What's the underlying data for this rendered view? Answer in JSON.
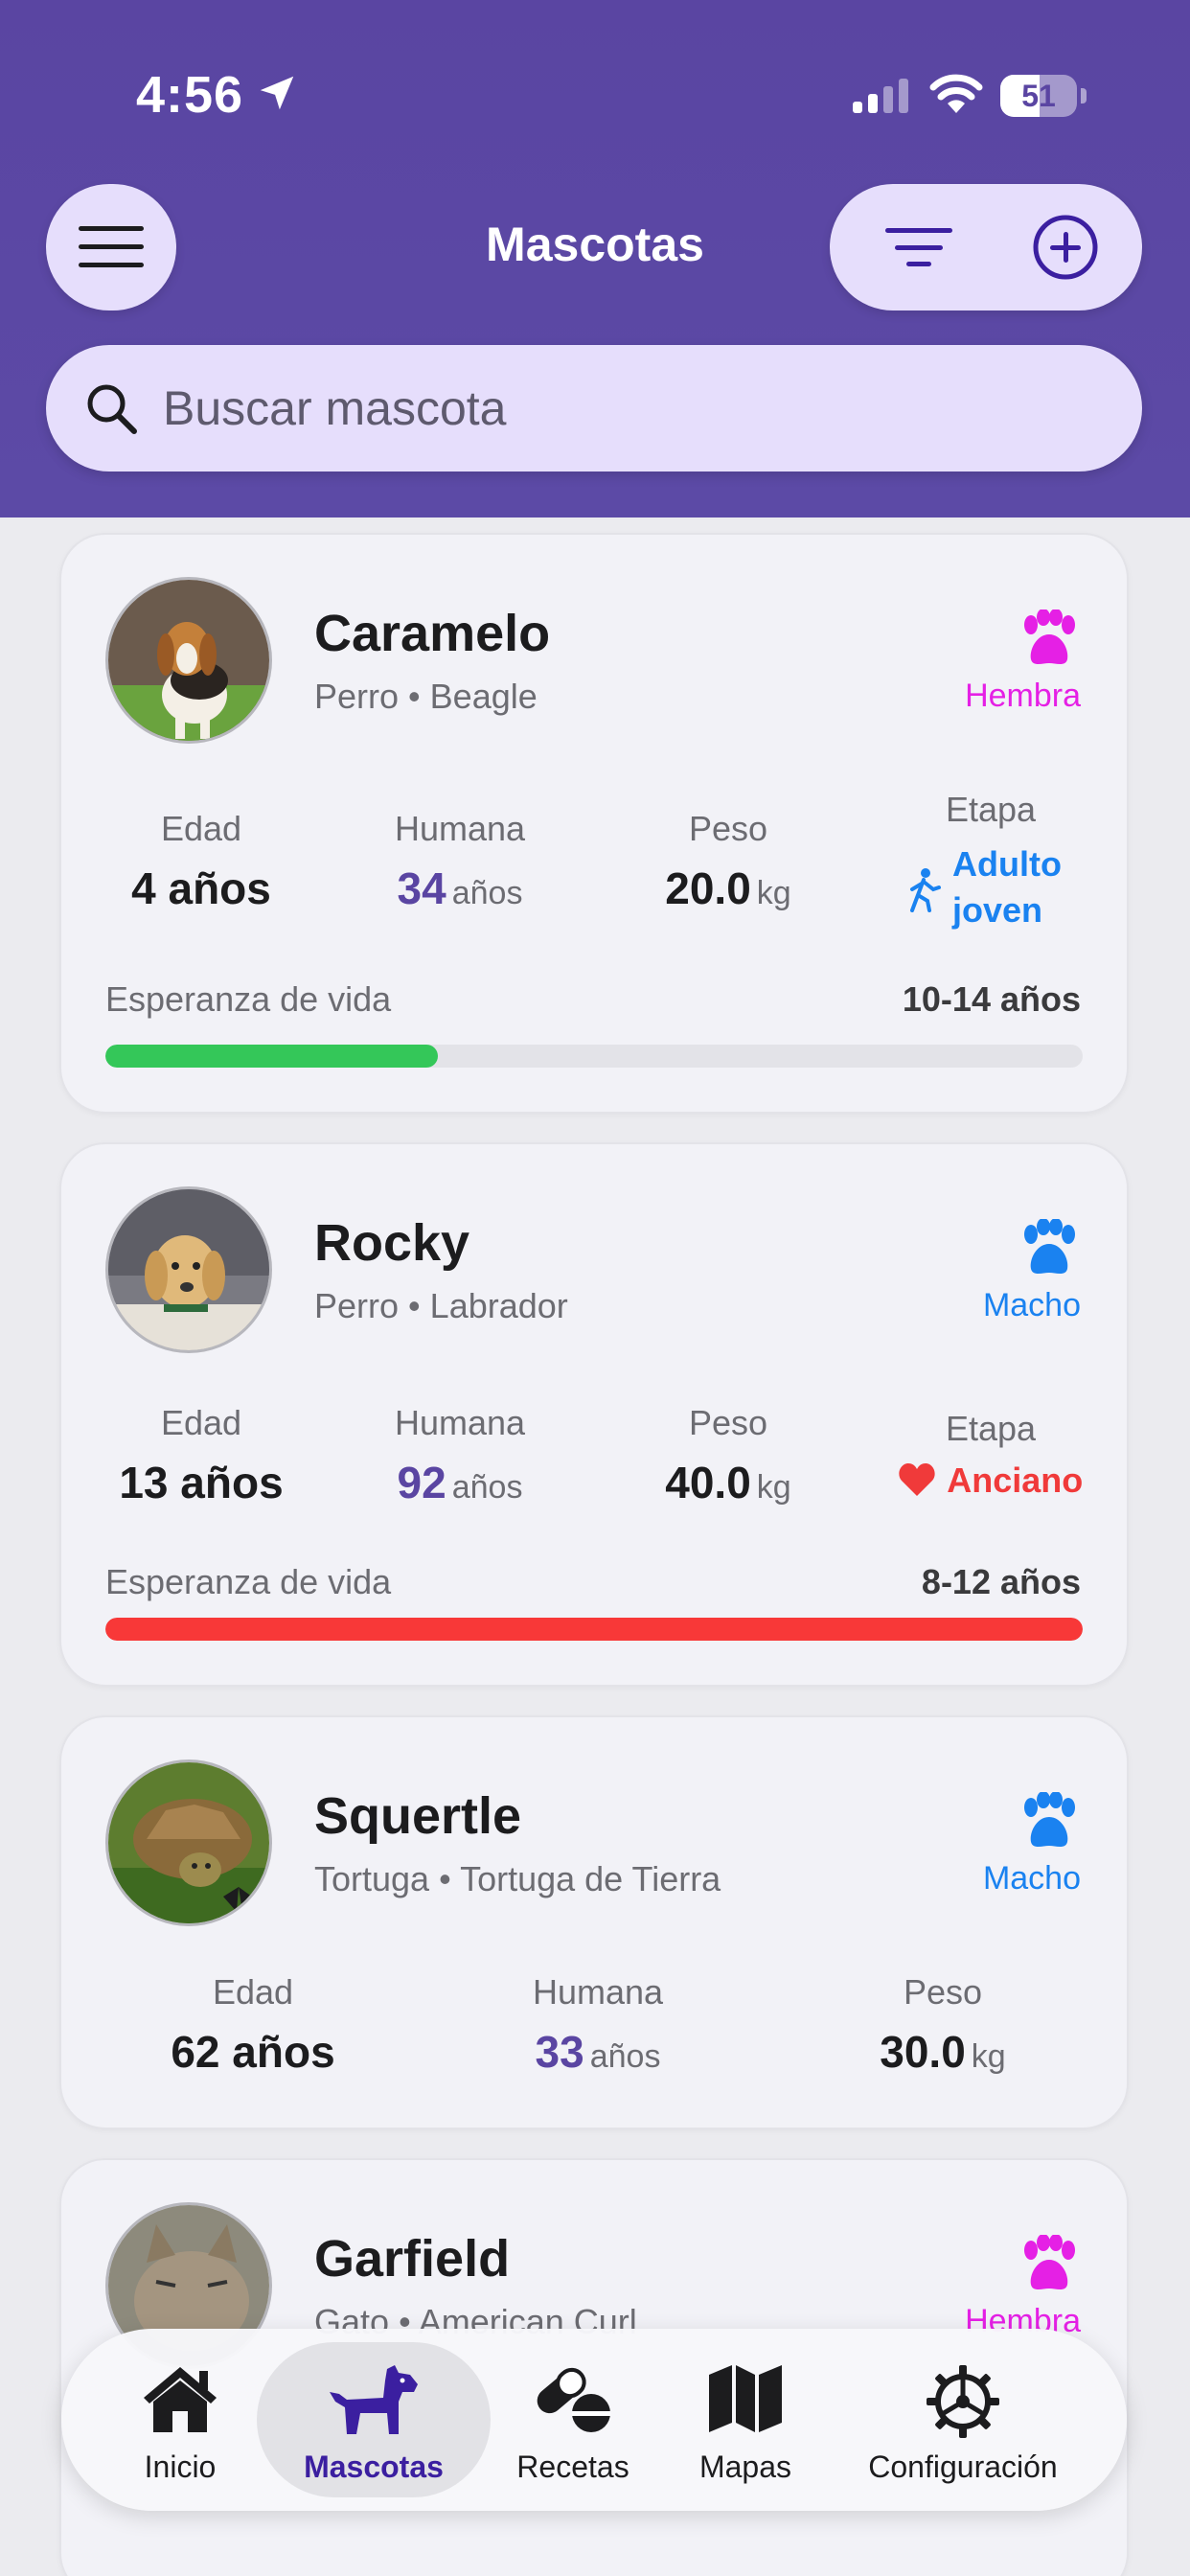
{
  "status_bar": {
    "time": "4:56",
    "battery": "51",
    "battery_level": 0.51
  },
  "header": {
    "title": "Mascotas",
    "menu_icon": "hamburger-icon",
    "filter_icon": "filter-icon",
    "add_icon": "plus-circle-icon"
  },
  "search": {
    "placeholder": "Buscar mascota",
    "value": ""
  },
  "colors": {
    "header": "#5a45a2",
    "accent": "#5a45a2",
    "female": "#e520e5",
    "male": "#1a82f0",
    "stage_adult": "#1a82f0",
    "stage_senior": "#f03a3a",
    "life_green": "#34c759",
    "life_red": "#f83838"
  },
  "pets": [
    {
      "name": "Caramelo",
      "species": "Perro",
      "breed": "Beagle",
      "gender": "Hembra",
      "labels": {
        "age": "Edad",
        "human": "Humana",
        "weight": "Peso",
        "stage": "Etapa"
      },
      "age": "4 años",
      "human_age": "34",
      "human_unit": "años",
      "weight": "20.0",
      "weight_unit": "kg",
      "stage": "Adulto joven",
      "life_label": "Esperanza de vida",
      "life_range": "10-14 años",
      "life_progress": 0.34
    },
    {
      "name": "Rocky",
      "species": "Perro",
      "breed": "Labrador",
      "gender": "Macho",
      "labels": {
        "age": "Edad",
        "human": "Humana",
        "weight": "Peso",
        "stage": "Etapa"
      },
      "age": "13 años",
      "human_age": "92",
      "human_unit": "años",
      "weight": "40.0",
      "weight_unit": "kg",
      "stage": "Anciano",
      "life_label": "Esperanza de vida",
      "life_range": "8-12 años",
      "life_progress": 1.0
    },
    {
      "name": "Squertle",
      "species": "Tortuga",
      "breed": "Tortuga de Tierra",
      "gender": "Macho",
      "labels": {
        "age": "Edad",
        "human": "Humana",
        "weight": "Peso"
      },
      "age": "62 años",
      "human_age": "33",
      "human_unit": "años",
      "weight": "30.0",
      "weight_unit": "kg"
    },
    {
      "name": "Garfield",
      "species": "Gato",
      "breed": "American Curl",
      "gender": "Hembra"
    }
  ],
  "separator": "•",
  "tabbar": [
    {
      "label": "Inicio",
      "icon": "house-icon"
    },
    {
      "label": "Mascotas",
      "icon": "dog-icon",
      "active": true
    },
    {
      "label": "Recetas",
      "icon": "pills-icon"
    },
    {
      "label": "Mapas",
      "icon": "map-icon"
    },
    {
      "label": "Configuración",
      "icon": "gear-icon"
    }
  ]
}
